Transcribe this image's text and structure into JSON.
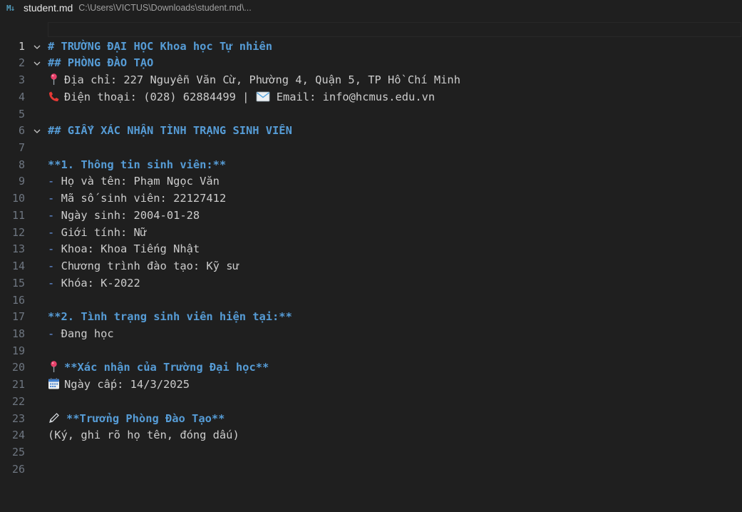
{
  "tab": {
    "icon": "markdown-icon",
    "icon_text": "M↓",
    "file_name": "student.md",
    "path": "C:\\Users\\VICTUS\\Downloads\\student.md\\..."
  },
  "editor": {
    "lines": [
      {
        "n": "1",
        "text": ""
      },
      {
        "n": "2",
        "text": "# TRƯỜNG ĐẠI HỌC Khoa học Tự nhiên"
      },
      {
        "n": "3",
        "text": "## PHÒNG ĐÀO TẠO"
      },
      {
        "n": "4",
        "icon": "pin-icon",
        "text": "Địa chỉ: 227 Nguyễn Văn Cừ, Phường 4, Quận 5, TP Hồ Chí Minh"
      },
      {
        "n": "5",
        "icon": "phone-icon",
        "text": "Điện thoại: (028) 62884499 |",
        "icon2": "envelope-icon",
        "text2": "Email: info@hcmus.edu.vn"
      },
      {
        "n": "6",
        "text": ""
      },
      {
        "n": "7",
        "text": "## GIẤY XÁC NHẬN TÌNH TRẠNG SINH VIÊN"
      },
      {
        "n": "8",
        "text": ""
      },
      {
        "n": "9",
        "text": "**1. Thông tin sinh viên:**"
      },
      {
        "n": "10",
        "dash": "-",
        "text": "Họ và tên: Phạm Ngọc Văn"
      },
      {
        "n": "11",
        "dash": "-",
        "text": "Mã số sinh viên: 22127412"
      },
      {
        "n": "12",
        "dash": "-",
        "text": "Ngày sinh: 2004-01-28"
      },
      {
        "n": "13",
        "dash": "-",
        "text": "Giới tính: Nữ"
      },
      {
        "n": "14",
        "dash": "-",
        "text": "Khoa: Khoa Tiếng Nhật"
      },
      {
        "n": "15",
        "dash": "-",
        "text": "Chương trình đào tạo: Kỹ sư"
      },
      {
        "n": "16",
        "dash": "-",
        "text": "Khóa: K-2022"
      },
      {
        "n": "17",
        "text": ""
      },
      {
        "n": "18",
        "text": "**2. Tình trạng sinh viên hiện tại:**"
      },
      {
        "n": "19",
        "dash": "-",
        "text": "Đang học"
      },
      {
        "n": "20",
        "text": ""
      },
      {
        "n": "21",
        "icon": "pin-icon",
        "text": "**Xác nhận của Trường Đại học**"
      },
      {
        "n": "22",
        "icon": "calendar-icon",
        "text": "Ngày cấp: 14/3/2025"
      },
      {
        "n": "23",
        "text": ""
      },
      {
        "n": "24",
        "icon": "pen-icon",
        "text": "**Trưởng Phòng Đào Tạo**"
      },
      {
        "n": "25",
        "text": "(Ký, ghi rõ họ tên, đóng dấu)"
      },
      {
        "n": "26",
        "text": ""
      }
    ]
  },
  "colors": {
    "background": "#1f1f1f",
    "text": "#cccccc",
    "heading": "#569cd6",
    "line_number": "#6e7681",
    "md_icon": "#519aba"
  }
}
